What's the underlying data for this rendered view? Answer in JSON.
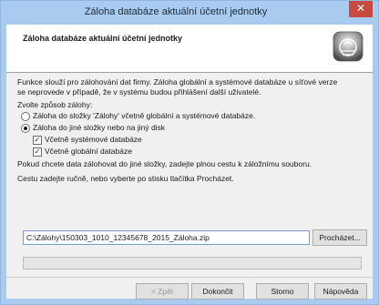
{
  "window": {
    "title": "Záloha databáze aktuální účetní jednotky",
    "close_glyph": "✕"
  },
  "header": {
    "title": "Záloha databáze aktuální účetní jednotky",
    "icon": "database-backup-icon"
  },
  "body": {
    "intro_line1": "Funkce slouží pro zálohování dat firmy. Záloha globální a systémové databáze u síťové verze",
    "intro_line2": "se neprovede v případě, že v systému budou přihlášení další uživatelé.",
    "choose_label": "Zvolte způsob zálohy:",
    "option1_label": "Záloha do složky 'Zálohy' včetně globální a systémové databáze.",
    "option2_label": "Záloha do jiné složky nebo na jiný disk",
    "option1_selected": false,
    "option2_selected": true,
    "check_system_label": "Včetně systémové databáze",
    "check_global_label": "Včetně globální databáze",
    "check_system_checked": true,
    "check_global_checked": true,
    "hint_other_folder": "Pokud chcete data zálohovat do jiné složky, zadejte plnou cestu k záložnímu souboru.",
    "hint_manual": "Cestu zadejte ručně, nebo vyberte po stisku tlačítka Procházet.",
    "path_value": "C:\\Zálohy\\150303_1010_12345678_2015_Záloha.zip",
    "browse_label": "Procházet...",
    "progress": 0
  },
  "footer": {
    "back_label": "< Zpět",
    "finish_label": "Dokončit",
    "cancel_label": "Storno",
    "help_label": "Nápověda"
  },
  "colors": {
    "titlebar": "#a9cbef",
    "close": "#c74a3f",
    "input_border": "#7a9cc6"
  }
}
